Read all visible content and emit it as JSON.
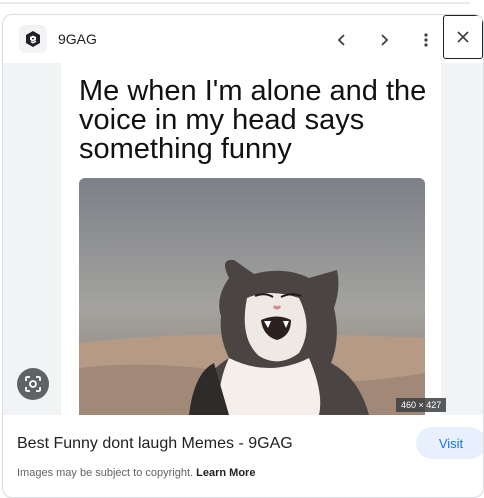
{
  "header": {
    "source_name": "9GAG",
    "icons": {
      "logo": "9gag-logo-icon",
      "prev": "chevron-left-icon",
      "next": "chevron-right-icon",
      "more": "more-vert-icon",
      "close": "close-icon"
    }
  },
  "image": {
    "caption": "Me when I'm alone and the voice in my head says something funny",
    "dimensions": "460 × 427",
    "lens_icon": "google-lens-icon"
  },
  "result": {
    "title": "Best Funny dont laugh Memes - 9GAG",
    "visit_label": "Visit",
    "copyright_text": "Images may be subject to copyright.",
    "learn_more_label": "Learn More"
  },
  "colors": {
    "accent": "#1a73e8",
    "visit_bg": "#e8f0fe",
    "text": "#202124",
    "muted": "#5f6368"
  }
}
